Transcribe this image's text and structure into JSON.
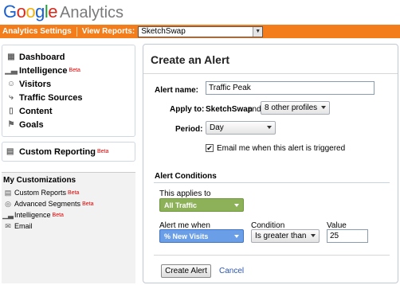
{
  "header": {
    "logo_google": "Google",
    "logo_analytics": "Analytics",
    "settings_link": "Analytics Settings",
    "view_reports_label": "View Reports:",
    "profile_select": "SketchSwap"
  },
  "nav": {
    "items": [
      {
        "label": "Dashboard",
        "icon": "dashboard-icon",
        "beta": ""
      },
      {
        "label": "Intelligence",
        "icon": "bar-chart-icon",
        "beta": "Beta"
      },
      {
        "label": "Visitors",
        "icon": "person-icon",
        "beta": ""
      },
      {
        "label": "Traffic Sources",
        "icon": "traffic-icon",
        "beta": ""
      },
      {
        "label": "Content",
        "icon": "page-icon",
        "beta": ""
      },
      {
        "label": "Goals",
        "icon": "flag-icon",
        "beta": ""
      }
    ],
    "custom_reporting": {
      "label": "Custom Reporting",
      "beta": "Beta"
    }
  },
  "my_customizations": {
    "title": "My Customizations",
    "items": [
      {
        "label": "Custom Reports",
        "beta": "Beta"
      },
      {
        "label": "Advanced Segments",
        "beta": "Beta"
      },
      {
        "label": "Intelligence",
        "beta": "Beta"
      },
      {
        "label": "Email",
        "beta": ""
      }
    ]
  },
  "form": {
    "title": "Create an Alert",
    "alert_name_label": "Alert name:",
    "alert_name_value": "Traffic Peak",
    "apply_to_label": "Apply to:",
    "apply_to_profile": "SketchSwap",
    "and_text": "and",
    "other_profiles": "8 other profiles",
    "period_label": "Period:",
    "period_value": "Day",
    "email_checkbox_label": "Email me when this alert is triggered",
    "email_checked": true
  },
  "conditions": {
    "header": "Alert Conditions",
    "applies_to_label": "This applies to",
    "applies_to_value": "All Traffic",
    "alert_when_label": "Alert me when",
    "alert_when_value": "% New Visits",
    "condition_label": "Condition",
    "condition_value": "Is greater than",
    "value_label": "Value",
    "value_value": "25"
  },
  "actions": {
    "create_button": "Create Alert",
    "cancel_link": "Cancel"
  },
  "colors": {
    "orange_bar": "#f27d1a",
    "green_pill": "#8db159",
    "blue_pill": "#6a9ee6",
    "beta": "#dd0000",
    "link": "#2a54b0"
  }
}
